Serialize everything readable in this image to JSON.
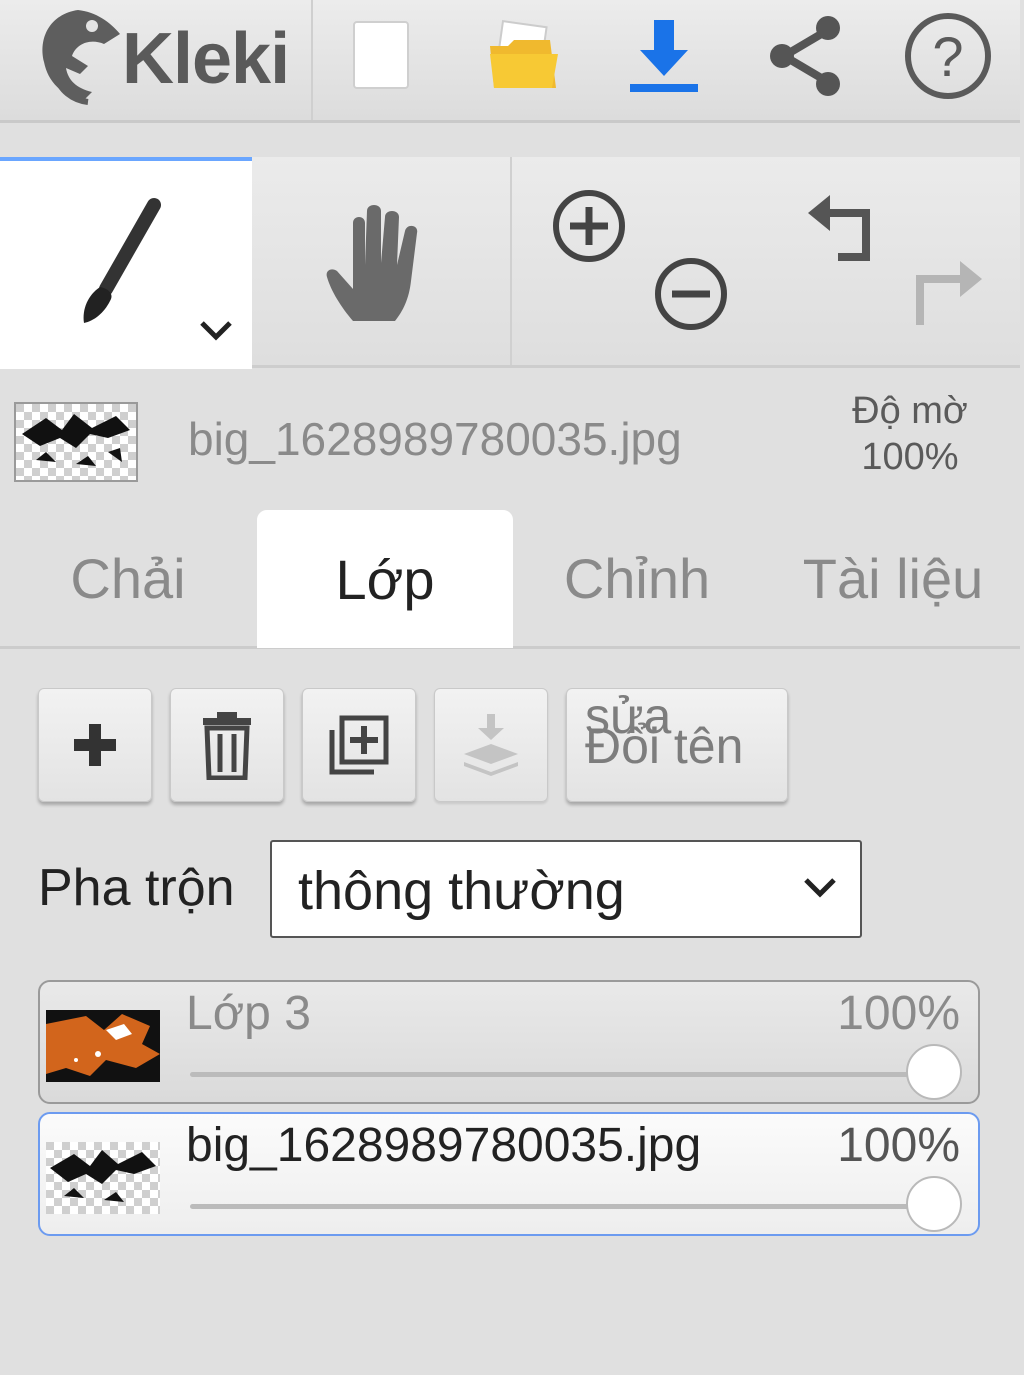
{
  "app": {
    "name": "Kleki"
  },
  "topbar": {
    "icons": [
      "new-file-icon",
      "open-folder-icon",
      "download-icon",
      "share-icon",
      "help-icon"
    ],
    "accent": "#1a73e8"
  },
  "tools": {
    "brush": "brush-icon",
    "hand": "hand-icon",
    "zoom_in": "zoom-in-icon",
    "zoom_out": "zoom-out-icon",
    "undo": "undo-icon",
    "redo": "redo-icon"
  },
  "current_layer": {
    "name": "big_1628989780035.jpg",
    "opacity_label": "Độ mờ",
    "opacity_value": "100%"
  },
  "tabs": [
    {
      "label": "Chải",
      "active": false
    },
    {
      "label": "Lớp",
      "active": true
    },
    {
      "label": "Chỉnh",
      "active": false
    },
    {
      "label": "Tài liệu",
      "active": false
    }
  ],
  "layer_actions": {
    "add": "plus-icon",
    "delete": "trash-icon",
    "duplicate": "duplicate-icon",
    "merge_down": "merge-down-icon",
    "rename_line1": "sửa",
    "rename_line2": "Đổi tên"
  },
  "blend": {
    "label": "Pha trộn",
    "value": "thông thường"
  },
  "layers": [
    {
      "name": "Lớp 3",
      "opacity": "100%",
      "opacity_fraction": 1.0,
      "selected": false
    },
    {
      "name": "big_1628989780035.jpg",
      "opacity": "100%",
      "opacity_fraction": 1.0,
      "selected": true
    }
  ],
  "colors": {
    "selection_border": "#6c9bf0",
    "layer3_thumb_orange": "#d2651c"
  }
}
